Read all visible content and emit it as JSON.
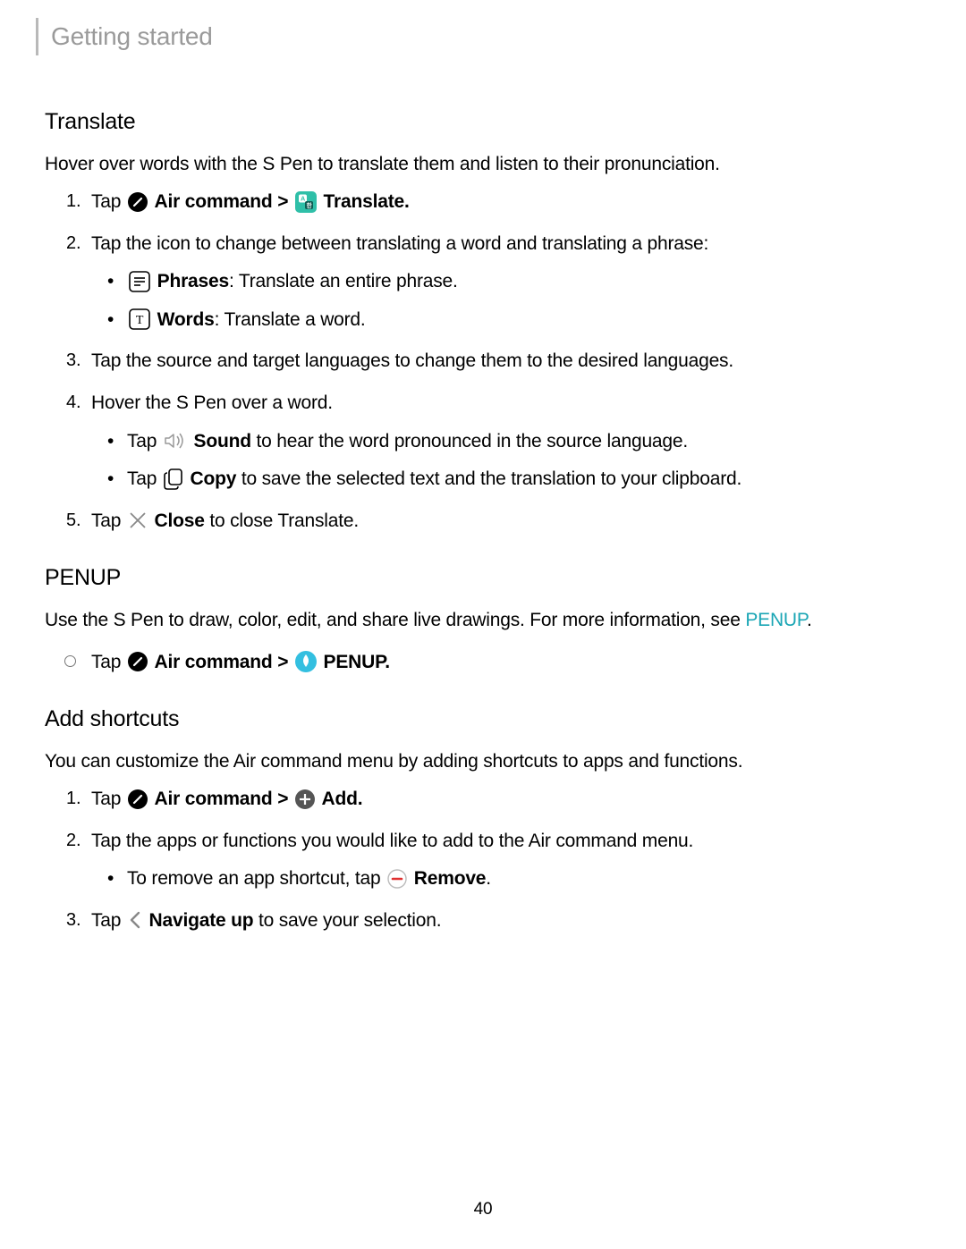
{
  "header": "Getting started",
  "pageNumber": "40",
  "translate": {
    "heading": "Translate",
    "intro": "Hover over words with the S Pen to translate them and listen to their pronunciation.",
    "step1_tap": "Tap",
    "air_command": "Air command",
    "gt": ">",
    "translate_label": "Translate",
    "period": ".",
    "step2": "Tap the icon to change between translating a word and translating a phrase:",
    "phrases_label": "Phrases",
    "phrases_desc": ": Translate an entire phrase.",
    "words_label": "Words",
    "words_desc": ": Translate a word.",
    "step3": "Tap the source and target languages to change them to the desired languages.",
    "step4": "Hover the S Pen over a word.",
    "sound_tap": "Tap",
    "sound_label": "Sound",
    "sound_desc": " to hear the word pronounced in the source language.",
    "copy_tap": "Tap",
    "copy_label": "Copy",
    "copy_desc": " to save the selected text and the translation to your clipboard.",
    "step5_tap": "Tap",
    "close_label": "Close",
    "close_desc": " to close Translate."
  },
  "penup": {
    "heading": "PENUP",
    "intro_a": "Use the S Pen to draw, color, edit, and share live drawings. For more information, see ",
    "link": "PENUP",
    "intro_b": ".",
    "tap": "Tap",
    "air_command": "Air command",
    "gt": ">",
    "penup_label": "PENUP",
    "period": "."
  },
  "shortcuts": {
    "heading": "Add shortcuts",
    "intro": "You can customize the Air command menu by adding shortcuts to apps and functions.",
    "step1_tap": "Tap",
    "air_command": "Air command",
    "gt": ">",
    "add_label": "Add",
    "period": ".",
    "step2": "Tap the apps or functions you would like to add to the Air command menu.",
    "remove_pre": "To remove an app shortcut, tap ",
    "remove_label": "Remove",
    "remove_post": ".",
    "step3_tap": "Tap",
    "nav_label": "Navigate up",
    "nav_desc": " to save your selection."
  }
}
